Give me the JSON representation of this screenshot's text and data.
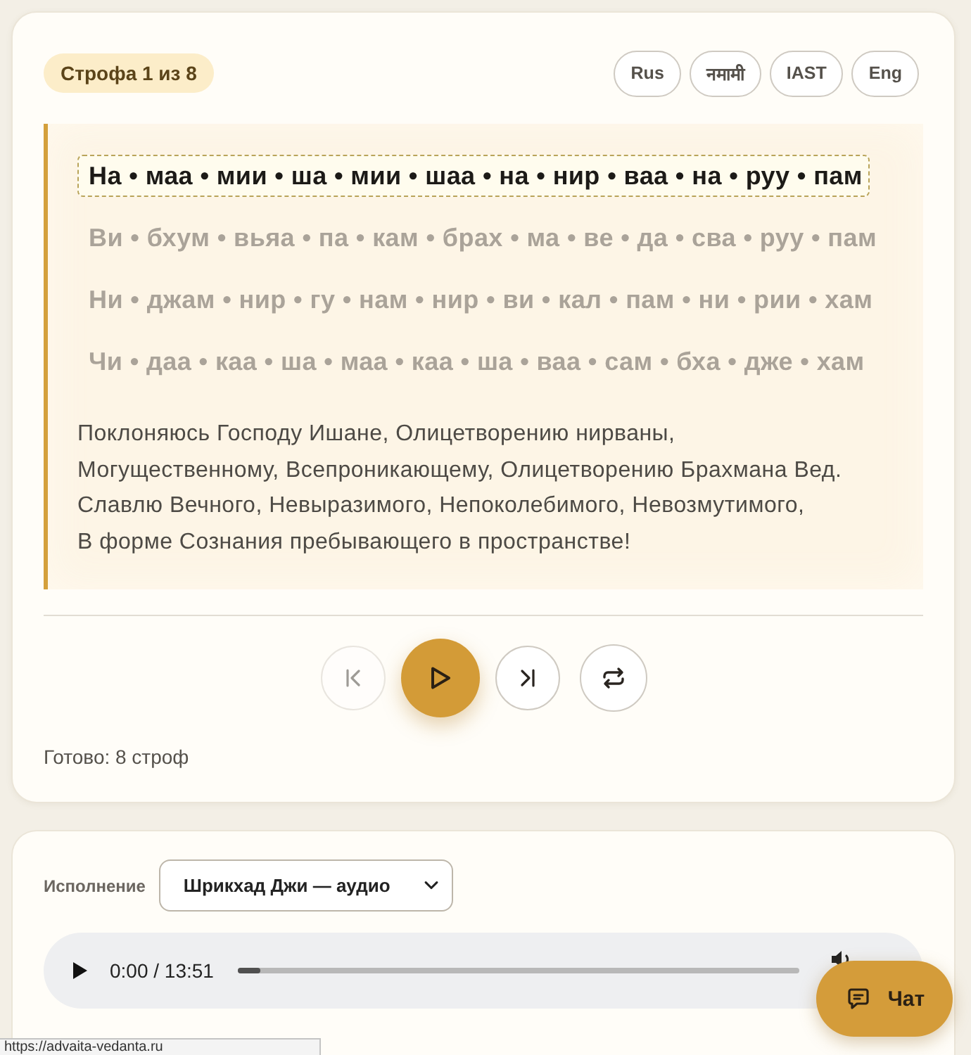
{
  "badge": "Строфа 1 из 8",
  "languages": [
    {
      "label": "Rus"
    },
    {
      "label": "नमामी"
    },
    {
      "label": "IAST"
    },
    {
      "label": "Eng"
    }
  ],
  "verse": {
    "lines": [
      {
        "text": "На • маа • мии • ша • мии • шаа • на • нир • ваа • на • руу • пам",
        "active": true
      },
      {
        "text": "Ви • бхум • вьяа • па • кам • брах • ма • ве • да • сва • руу • пам",
        "active": false
      },
      {
        "text": "Ни • джам • нир • гу • нам • нир • ви • кал • пам • ни • рии • хам",
        "active": false
      },
      {
        "text": "Чи • даа • каа • ша • маа • каа • ша • ваа • сам • бха • дже • хам",
        "active": false
      }
    ],
    "translation": [
      "Поклоняюсь Господу Ишане, Олицетворению нирваны,",
      "Могущественному, Всепроникающему, Олицетворению Брахмана Вед.",
      "Славлю Вечного, Невыразимого, Непоколебимого, Невозмутимого,",
      "В форме Сознания пребывающего в пространстве!"
    ]
  },
  "controls": [
    {
      "kind": "previous",
      "disabled": true
    },
    {
      "kind": "play",
      "disabled": false
    },
    {
      "kind": "next",
      "disabled": false
    },
    {
      "kind": "repeat",
      "disabled": false
    }
  ],
  "status": "Готово: 8 строф",
  "performance": {
    "label": "Исполнение",
    "value": "Шрикхад Джи — аудио"
  },
  "audio": {
    "time": "0:00 / 13:51",
    "level": 0.04
  },
  "chat": {
    "label": "Чат"
  },
  "link_preview": "https://advaita-vedanta.ru"
}
